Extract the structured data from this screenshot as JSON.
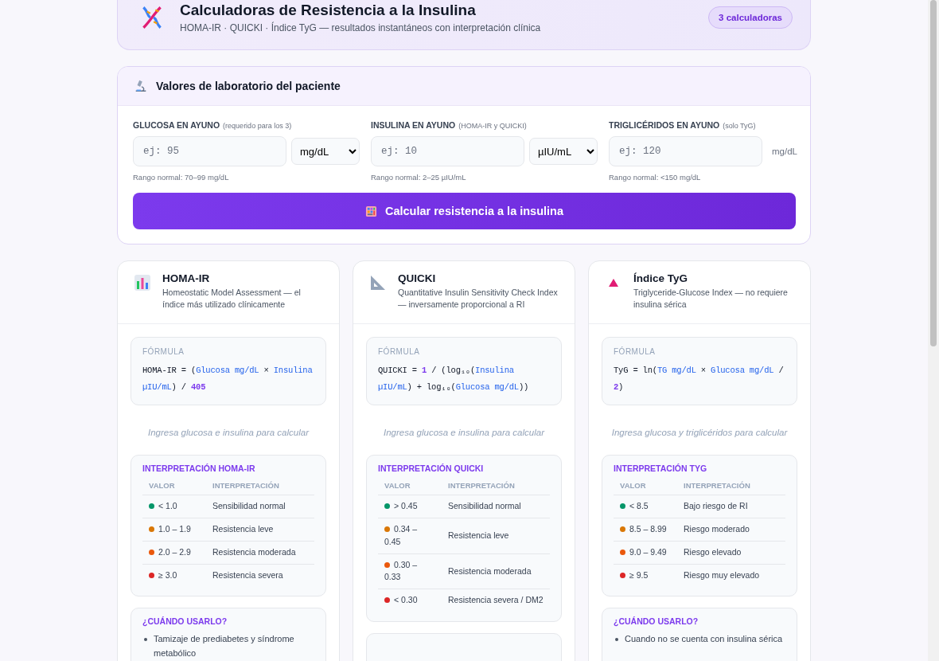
{
  "header": {
    "title": "Calculadoras de Resistencia a la Insulina",
    "subtitle": "HOMA-IR · QUICKI · Índice TyG — resultados instantáneos con interpretación clínica",
    "badge": "3 calculadoras"
  },
  "lab": {
    "title": "Valores de laboratorio del paciente",
    "fields": [
      {
        "label": "GLUCOSA EN AYUNO",
        "hint": "(requerido para los 3)",
        "placeholder": "ej: 95",
        "kind": "select",
        "unit": "mg/dL",
        "range": "Rango normal: 70–99 mg/dL"
      },
      {
        "label": "INSULINA EN AYUNO",
        "hint": "(HOMA-IR y QUICKI)",
        "placeholder": "ej: 10",
        "kind": "select",
        "unit": "µIU/mL",
        "range": "Rango normal: 2–25 µIU/mL"
      },
      {
        "label": "TRIGLICÉRIDOS EN AYUNO",
        "hint": "(solo TyG)",
        "placeholder": "ej: 120",
        "kind": "text",
        "unit": "mg/dL",
        "range": "Rango normal: <150 mg/dL"
      }
    ],
    "button": "Calcular resistencia a la insulina"
  },
  "calculators": [
    {
      "kind": "bars",
      "title": "HOMA-IR",
      "subtitle": "Homeostatic Model Assessment — el índice más utilizado clínicamente",
      "formula_label": "FÓRMULA",
      "formula": [
        {
          "kind": "text",
          "t": "HOMA-IR = ("
        },
        {
          "kind": "var",
          "t": "Glucosa mg/dL"
        },
        {
          "kind": "text",
          "t": " × "
        },
        {
          "kind": "var",
          "t": "Insulina µIU/mL"
        },
        {
          "kind": "text",
          "t": ") / "
        },
        {
          "kind": "num",
          "t": "405"
        }
      ],
      "prompt": "Ingresa glucosa e insulina para calcular",
      "table_title": "INTERPRETACIÓN HOMA-IR",
      "columns": [
        "VALOR",
        "INTERPRETACIÓN"
      ],
      "rows": [
        {
          "value": "< 1.0",
          "meaning": "Sensibilidad normal",
          "color": "#059669"
        },
        {
          "value": "1.0 – 1.9",
          "meaning": "Resistencia leve",
          "color": "#d97706"
        },
        {
          "value": "2.0 – 2.9",
          "meaning": "Resistencia moderada",
          "color": "#ea580c"
        },
        {
          "value": "≥ 3.0",
          "meaning": "Resistencia severa",
          "color": "#dc2626"
        }
      ],
      "usage_title": "¿CUÁNDO USARLO?",
      "usage": [
        "Tamizaje de prediabetes y síndrome metabólico"
      ]
    },
    {
      "kind": "ruler",
      "title": "QUICKI",
      "subtitle": "Quantitative Insulin Sensitivity Check Index — inversamente proporcional a RI",
      "formula_label": "FÓRMULA",
      "formula": [
        {
          "kind": "text",
          "t": "QUICKI = "
        },
        {
          "kind": "num",
          "t": "1"
        },
        {
          "kind": "text",
          "t": " / (log₁₀("
        },
        {
          "kind": "var",
          "t": "Insulina µIU/mL"
        },
        {
          "kind": "text",
          "t": ") + log₁₀("
        },
        {
          "kind": "var",
          "t": "Glucosa mg/dL"
        },
        {
          "kind": "text",
          "t": "))"
        }
      ],
      "prompt": "Ingresa glucosa e insulina para calcular",
      "table_title": "INTERPRETACIÓN QUICKI",
      "columns": [
        "VALOR",
        "INTERPRETACIÓN"
      ],
      "rows": [
        {
          "value": "> 0.45",
          "meaning": "Sensibilidad normal",
          "color": "#059669"
        },
        {
          "value": "0.34 – 0.45",
          "meaning": "Resistencia leve",
          "color": "#d97706"
        },
        {
          "value": "0.30 – 0.33",
          "meaning": "Resistencia moderada",
          "color": "#ea580c"
        },
        {
          "value": "< 0.30",
          "meaning": "Resistencia severa / DM2",
          "color": "#dc2626"
        }
      ]
    },
    {
      "kind": "triangle",
      "title": "Índice TyG",
      "subtitle": "Triglyceride-Glucose Index — no requiere insulina sérica",
      "formula_label": "FÓRMULA",
      "formula": [
        {
          "kind": "text",
          "t": "TyG = ln("
        },
        {
          "kind": "var",
          "t": "TG mg/dL"
        },
        {
          "kind": "text",
          "t": " × "
        },
        {
          "kind": "var",
          "t": "Glucosa mg/dL"
        },
        {
          "kind": "text",
          "t": " / "
        },
        {
          "kind": "num",
          "t": "2"
        },
        {
          "kind": "text",
          "t": ")"
        }
      ],
      "prompt": "Ingresa glucosa y triglicéridos para calcular",
      "table_title": "INTERPRETACIÓN TYG",
      "columns": [
        "VALOR",
        "INTERPRETACIÓN"
      ],
      "rows": [
        {
          "value": "< 8.5",
          "meaning": "Bajo riesgo de RI",
          "color": "#059669"
        },
        {
          "value": "8.5 – 8.99",
          "meaning": "Riesgo moderado",
          "color": "#d97706"
        },
        {
          "value": "9.0 – 9.49",
          "meaning": "Riesgo elevado",
          "color": "#ea580c"
        },
        {
          "value": "≥ 9.5",
          "meaning": "Riesgo muy elevado",
          "color": "#dc2626"
        }
      ],
      "usage_title": "¿CUÁNDO USARLO?",
      "usage": [
        "Cuando no se cuenta con insulina sérica"
      ]
    }
  ]
}
